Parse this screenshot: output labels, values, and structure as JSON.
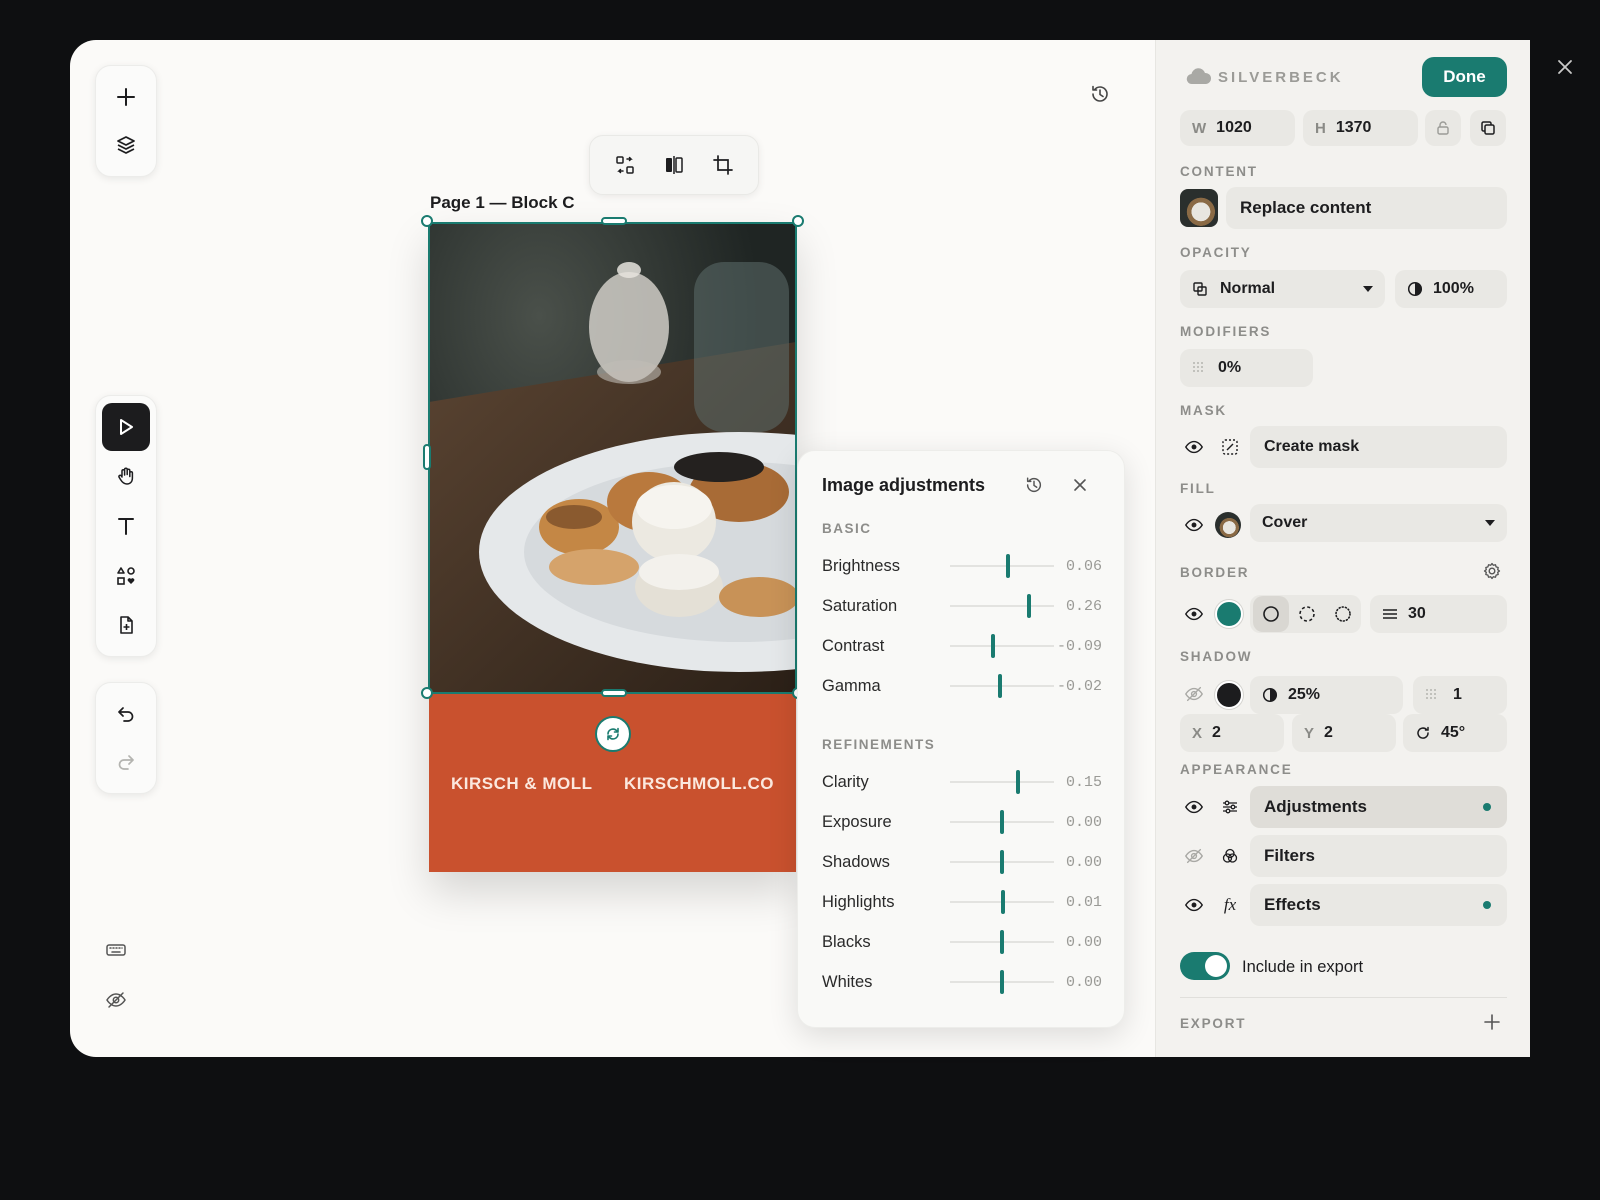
{
  "canvas": {
    "block_label": "Page 1 — Block C",
    "banner_left": "KIRSCH & MOLL",
    "banner_right": "KIRSCHMOLL.CO",
    "banner_color": "#c9512e",
    "accent_color": "#1a7b70"
  },
  "left_toolbar_top": [
    {
      "name": "add",
      "icon": "plus-icon"
    },
    {
      "name": "layers",
      "icon": "layers-icon"
    }
  ],
  "left_toolbar_tools": [
    {
      "name": "select",
      "icon": "cursor-icon",
      "active": true
    },
    {
      "name": "hand",
      "icon": "hand-icon"
    },
    {
      "name": "text",
      "icon": "text-icon"
    },
    {
      "name": "shapes",
      "icon": "shapes-icon"
    },
    {
      "name": "add-page",
      "icon": "file-plus-icon"
    }
  ],
  "left_toolbar_history": [
    {
      "name": "undo",
      "icon": "undo-icon"
    },
    {
      "name": "redo",
      "icon": "redo-icon"
    }
  ],
  "adjustments": {
    "title": "Image adjustments",
    "basic_label": "BASIC",
    "refinements_label": "REFINEMENTS",
    "basic": [
      {
        "label": "Brightness",
        "value": "0.06",
        "num": 0.06
      },
      {
        "label": "Saturation",
        "value": "0.26",
        "num": 0.26
      },
      {
        "label": "Contrast",
        "value": "-0.09",
        "num": -0.09
      },
      {
        "label": "Gamma",
        "value": "-0.02",
        "num": -0.02
      }
    ],
    "refinements": [
      {
        "label": "Clarity",
        "value": "0.15",
        "num": 0.15
      },
      {
        "label": "Exposure",
        "value": "0.00",
        "num": 0.0
      },
      {
        "label": "Shadows",
        "value": "0.00",
        "num": 0.0
      },
      {
        "label": "Highlights",
        "value": "0.01",
        "num": 0.01
      },
      {
        "label": "Blacks",
        "value": "0.00",
        "num": 0.0
      },
      {
        "label": "Whites",
        "value": "0.00",
        "num": 0.0
      }
    ]
  },
  "sidebar": {
    "brand": "SILVERBECK",
    "done": "Done",
    "w_label": "W",
    "w_value": "1020",
    "h_label": "H",
    "h_value": "1370",
    "content_label": "CONTENT",
    "replace_content": "Replace content",
    "opacity_label": "OPACITY",
    "blend_mode": "Normal",
    "opacity_value": "100%",
    "modifiers_label": "MODIFIERS",
    "modifiers_value": "0%",
    "mask_label": "MASK",
    "create_mask": "Create mask",
    "fill_label": "FILL",
    "fill_mode": "Cover",
    "border_label": "BORDER",
    "border_color": "#1a7b70",
    "border_width": "30",
    "shadow_label": "SHADOW",
    "shadow_color": "#1c1c1e",
    "shadow_opacity": "25%",
    "shadow_blur": "1",
    "shadow_x_label": "X",
    "shadow_x": "2",
    "shadow_y_label": "Y",
    "shadow_y": "2",
    "shadow_angle": "45°",
    "appearance_label": "APPEARANCE",
    "appearance": [
      {
        "label": "Adjustments",
        "visible": true,
        "dot": true
      },
      {
        "label": "Filters",
        "visible": false,
        "dot": false
      },
      {
        "label": "Effects",
        "visible": true,
        "dot": true
      }
    ],
    "fx_glyph": "fx",
    "include_export": "Include in export",
    "export_label": "EXPORT"
  }
}
